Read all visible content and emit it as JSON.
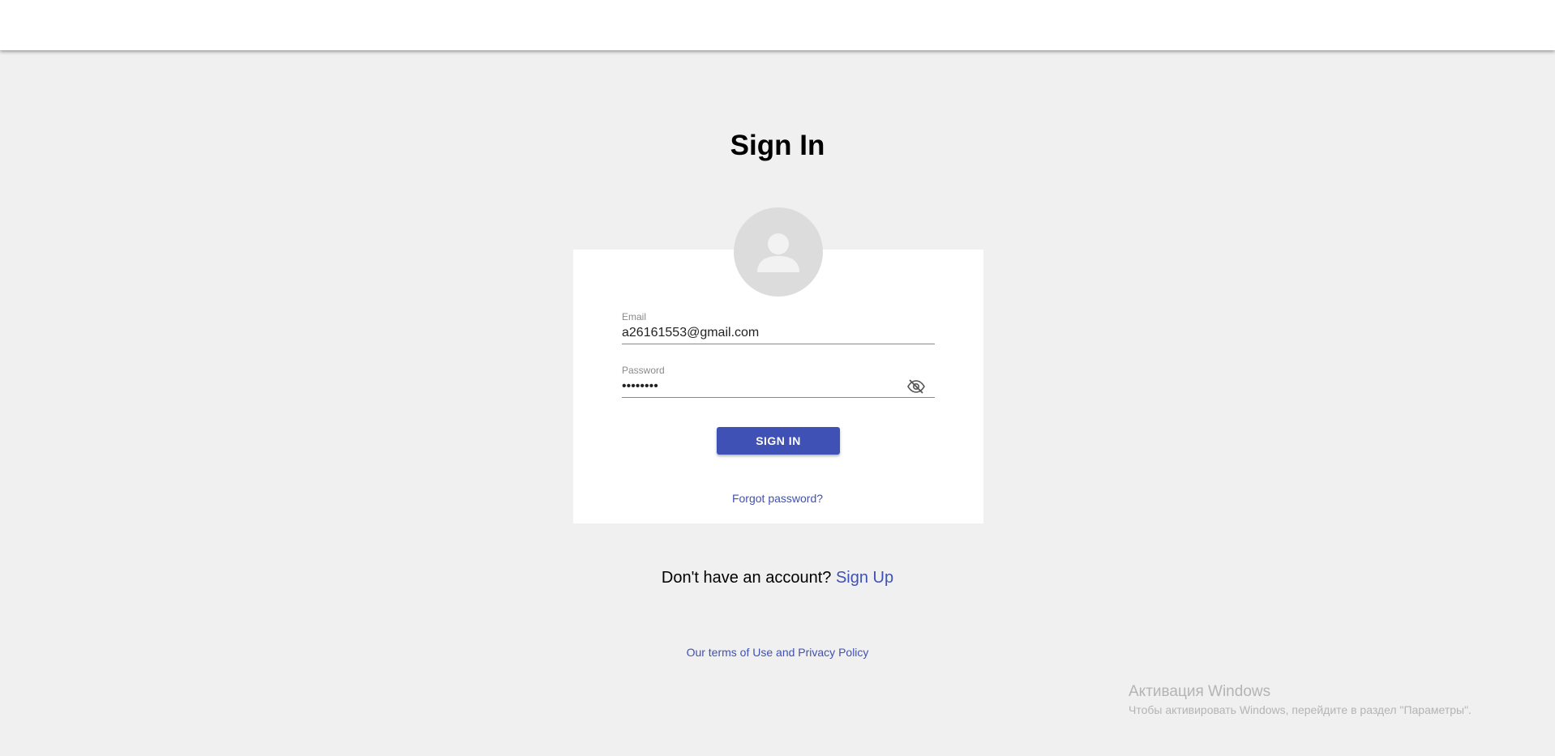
{
  "page": {
    "title": "Sign In"
  },
  "form": {
    "email_label": "Email",
    "email_value": "a26161553@gmail.com",
    "password_label": "Password",
    "password_value": "••••••••",
    "submit_label": "SIGN IN",
    "forgot_label": "Forgot password?"
  },
  "footer": {
    "signup_prompt": "Don't have an account?",
    "signup_link": "Sign Up",
    "terms_link": "Our terms of Use and Privacy Policy"
  },
  "watermark": {
    "title": "Активация Windows",
    "subtitle": "Чтобы активировать Windows, перейдите в раздел \"Параметры\"."
  },
  "icons": {
    "avatar": "person-icon",
    "password_toggle": "eye-off-icon"
  },
  "colors": {
    "accent": "#3f51b5",
    "background": "#f0f0f0",
    "card": "#ffffff",
    "avatar_bg": "#dcdcdc"
  }
}
